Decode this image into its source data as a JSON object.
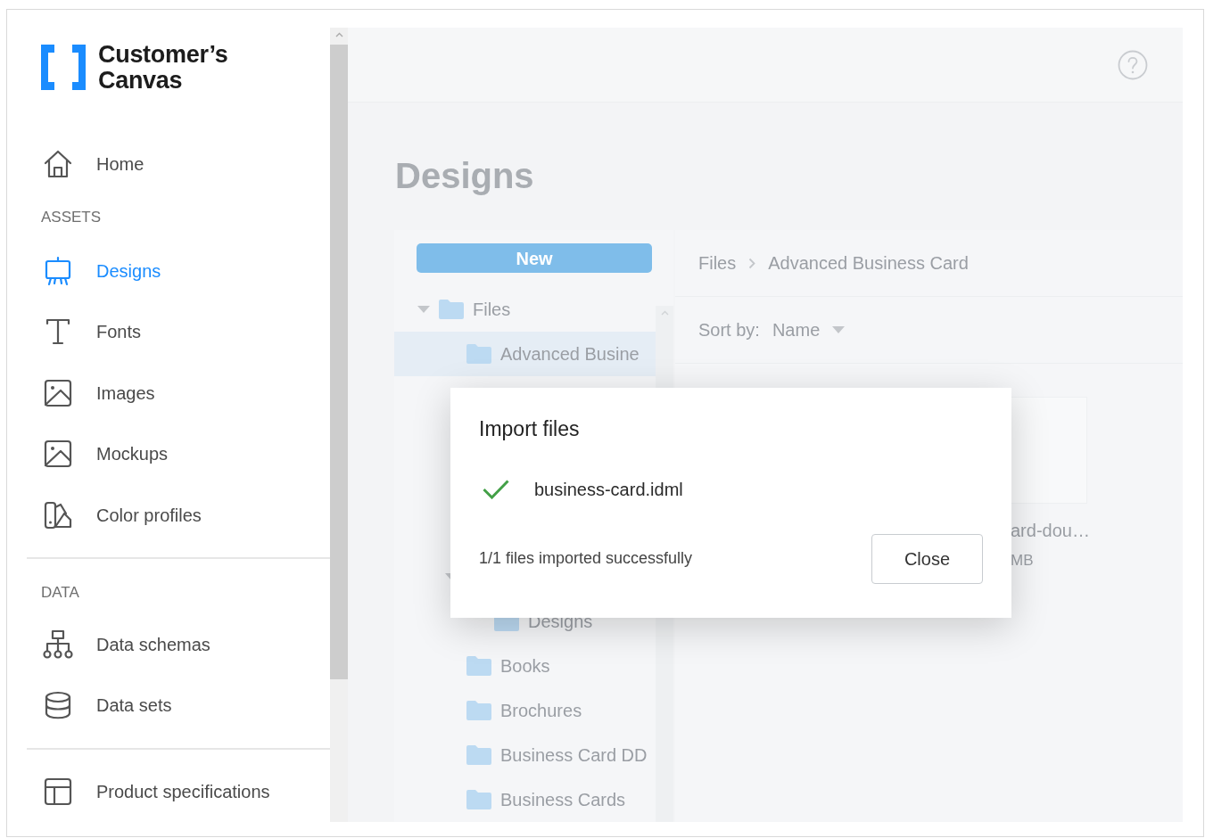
{
  "sidebar": {
    "logo": {
      "line_1": "Customer’s",
      "line_2": "Canvas"
    },
    "groups": [
      {
        "divider": false,
        "items": [
          {
            "label": "Home",
            "selected": false
          }
        ]
      },
      {
        "divider": false,
        "heading": "ASSETS",
        "items": [
          {
            "label": "Designs",
            "selected": true
          },
          {
            "label": "Fonts",
            "selected": false
          },
          {
            "label": "Images",
            "selected": false
          },
          {
            "label": "Mockups",
            "selected": false
          },
          {
            "label": "Color profiles",
            "selected": false
          }
        ]
      },
      {
        "divider": true,
        "heading": "DATA",
        "items": [
          {
            "label": "Data schemas",
            "selected": false
          },
          {
            "label": "Data sets",
            "selected": false
          }
        ]
      },
      {
        "divider": true,
        "items": [
          {
            "label": "Product specifications",
            "selected": false
          }
        ]
      }
    ]
  },
  "main": {
    "title": "Designs",
    "new_button": "New",
    "tree": [
      {
        "label": "Files",
        "selected": false,
        "expanded": true,
        "children": [
          {
            "label": "Advanced Busine",
            "selected": true
          },
          {
            "selected": false,
            "expanded": true,
            "children": [
              {
                "label": "Designs",
                "selected": false
              }
            ]
          },
          {
            "label": "Books",
            "selected": false
          },
          {
            "label": "Brochures",
            "selected": false
          },
          {
            "label": "Business Card DD",
            "selected": false
          },
          {
            "label": "Business Cards",
            "selected": false
          }
        ]
      }
    ],
    "breadcrumb": [
      "Files",
      "Advanced Business Card"
    ],
    "sort": {
      "label": "Sort by:",
      "value": "Name"
    },
    "file_card": {
      "name": "ard-dou…",
      "size": "MB"
    }
  },
  "dialog": {
    "title": "Import files",
    "files": [
      {
        "name": "business-card.idml"
      }
    ],
    "summary": "1/1 files imported successfully",
    "close_button": "Close"
  }
}
